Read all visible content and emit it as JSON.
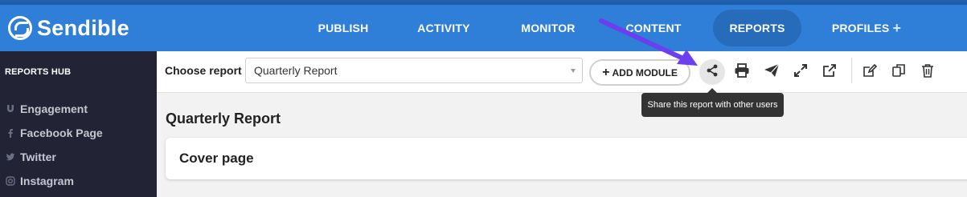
{
  "app": {
    "name": "Sendible",
    "logo_icon": "sendible-logo-icon"
  },
  "nav": {
    "items": [
      {
        "label": "PUBLISH"
      },
      {
        "label": "ACTIVITY"
      },
      {
        "label": "MONITOR"
      },
      {
        "label": "CONTENT"
      },
      {
        "label": "REPORTS",
        "active": true
      },
      {
        "label": "PROFILES",
        "suffix": "+"
      }
    ]
  },
  "sidebar": {
    "title": "REPORTS HUB",
    "items": [
      {
        "label": "Engagement",
        "icon": "magnet-icon"
      },
      {
        "label": "Facebook Page",
        "icon": "facebook-icon"
      },
      {
        "label": "Twitter",
        "icon": "twitter-icon"
      },
      {
        "label": "Instagram",
        "icon": "instagram-icon"
      }
    ]
  },
  "toolbar": {
    "choose_label": "Choose report",
    "report_select_value": "Quarterly Report",
    "add_module_label": "ADD MODULE",
    "tools": [
      {
        "icon": "share-icon"
      },
      {
        "icon": "print-icon"
      },
      {
        "icon": "send-icon"
      },
      {
        "icon": "expand-icon"
      },
      {
        "icon": "external-link-icon"
      },
      {
        "icon": "edit-icon"
      },
      {
        "icon": "duplicate-icon"
      },
      {
        "icon": "trash-icon"
      }
    ]
  },
  "tooltip": {
    "text": "Share this report with other users"
  },
  "main": {
    "report_title": "Quarterly Report",
    "cover_title": "Cover page"
  },
  "colors": {
    "topbar": "#2f7fd8",
    "sidebar": "#222436",
    "annotation_arrow": "#6b3ff0"
  }
}
